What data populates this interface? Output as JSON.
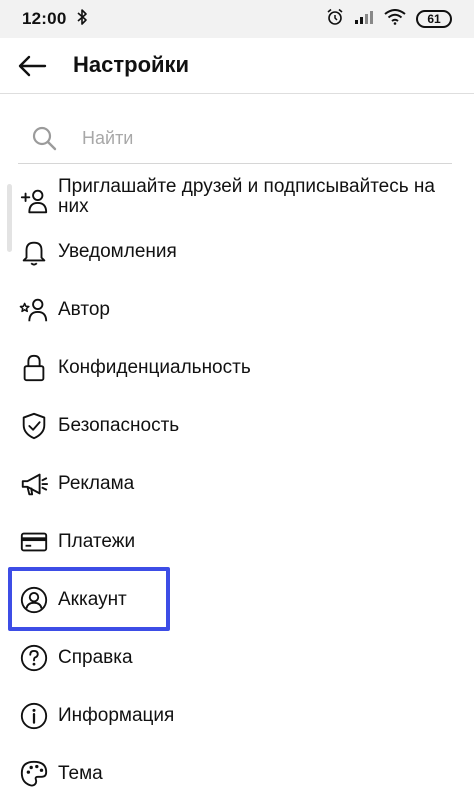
{
  "status_bar": {
    "time": "12:00",
    "battery": "61"
  },
  "app_bar": {
    "title": "Настройки"
  },
  "search": {
    "placeholder": "Найти"
  },
  "menu": {
    "items": [
      {
        "label": "Приглашайте друзей и подписывайтесь на них",
        "icon": "add-friend-icon"
      },
      {
        "label": "Уведомления",
        "icon": "bell-icon"
      },
      {
        "label": "Автор",
        "icon": "creator-icon"
      },
      {
        "label": "Конфиденциальность",
        "icon": "lock-icon"
      },
      {
        "label": "Безопасность",
        "icon": "shield-check-icon"
      },
      {
        "label": "Реклама",
        "icon": "megaphone-icon"
      },
      {
        "label": "Платежи",
        "icon": "card-icon"
      },
      {
        "label": "Аккаунт",
        "icon": "account-circle-icon"
      },
      {
        "label": "Справка",
        "icon": "help-circle-icon"
      },
      {
        "label": "Информация",
        "icon": "info-circle-icon"
      },
      {
        "label": "Тема",
        "icon": "palette-icon"
      }
    ]
  },
  "colors": {
    "highlight": "#3d4de6",
    "status_bar_bg": "#f2f2f2",
    "placeholder": "#a8a8a8"
  }
}
